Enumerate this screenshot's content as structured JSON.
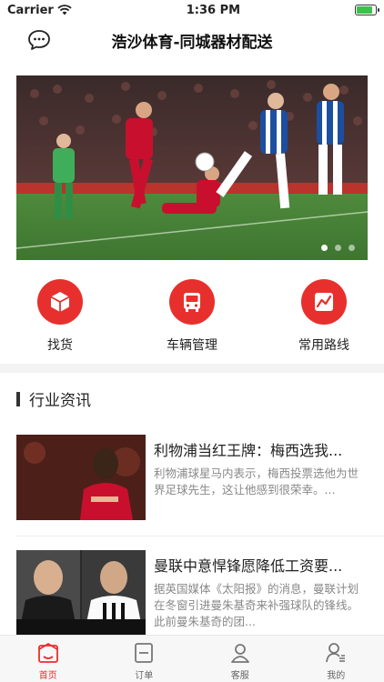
{
  "status": {
    "carrier": "Carrier",
    "time": "1:36 PM",
    "battery_level": 0.85
  },
  "header": {
    "title": "浩沙体育-同城器材配送",
    "icon": "message-icon"
  },
  "banner": {
    "slide_count": 3,
    "active_index": 0
  },
  "quick_actions": [
    {
      "label": "找货",
      "icon": "cube-icon"
    },
    {
      "label": "车辆管理",
      "icon": "bus-icon"
    },
    {
      "label": "常用路线",
      "icon": "route-icon"
    }
  ],
  "section": {
    "title": "行业资讯"
  },
  "news": [
    {
      "title": "利物浦当红王牌：梅西选我...",
      "desc": "利物浦球星马内表示，梅西投票选他为世界足球先生，这让他感到很荣幸。...",
      "thumb_text": ""
    },
    {
      "title": "曼联中意悍锋愿降低工资要...",
      "desc": "据英国媒体《太阳报》的消息，曼联计划在冬窗引进曼朱基奇来补强球队的锋线。此前曼朱基奇的团...",
      "thumb_text": "MY MAN Utd boost as Mandzukic slashes £300k-a-week wage demands in half to seal £10m move"
    }
  ],
  "tabs": [
    {
      "label": "首页",
      "icon": "home-icon",
      "active": true
    },
    {
      "label": "订单",
      "icon": "order-icon",
      "active": false
    },
    {
      "label": "客服",
      "icon": "service-icon",
      "active": false
    },
    {
      "label": "我的",
      "icon": "profile-icon",
      "active": false
    }
  ],
  "colors": {
    "accent": "#e7302d",
    "text": "#222222",
    "muted": "#888888"
  }
}
